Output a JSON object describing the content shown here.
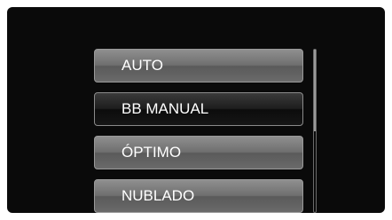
{
  "menu": {
    "items": [
      {
        "label": "AUTO"
      },
      {
        "label": "BB MANUAL"
      },
      {
        "label": "ÓPTIMO"
      },
      {
        "label": "NUBLADO"
      }
    ],
    "selected_index": 1
  },
  "scrollbar": {
    "position_fraction": 0.0,
    "visible_fraction": 0.5
  },
  "colors": {
    "screen_background": "#0a0a0a",
    "item_normal": "#7a7a7a",
    "item_selected": "#1a1a1a",
    "text": "#ffffff"
  }
}
